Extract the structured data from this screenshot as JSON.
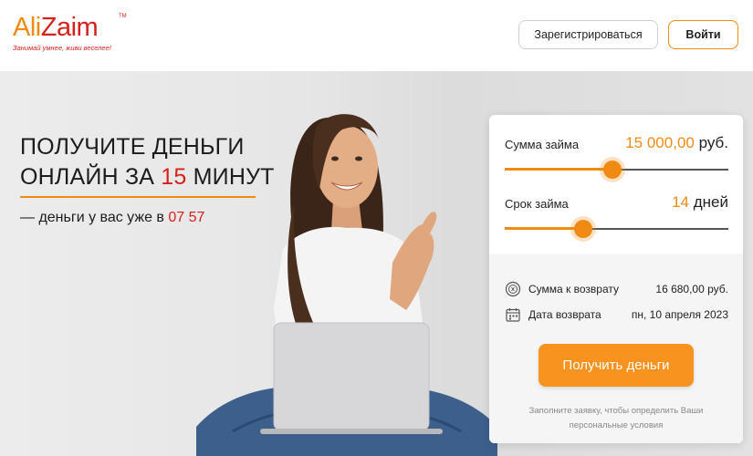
{
  "brand": {
    "logo_ali": "Ali",
    "logo_zaim": "Zaim",
    "trademark": "TM",
    "slogan": "Занимай умнее, живи веселее!",
    "accent_orange": "#f08a12",
    "accent_red": "#d4211c"
  },
  "header": {
    "register_label": "Зарегистрироваться",
    "login_label": "Войти"
  },
  "hero": {
    "headline_line1": "ПОЛУЧИТЕ ДЕНЬГИ",
    "headline_line2_pre": "ОНЛАЙН ЗА ",
    "headline_line2_num": "15",
    "headline_line2_post": " МИНУТ",
    "sub_pre": "— деньги у вас уже в ",
    "sub_time": "07 57"
  },
  "calculator": {
    "amount_label": "Сумма займа",
    "amount_value": "15 000,00",
    "amount_unit": " руб.",
    "amount_slider_fraction": 0.48,
    "term_label": "Срок займа",
    "term_value": "14",
    "term_unit": " дней",
    "term_slider_fraction": 0.35,
    "return_sum_label": "Сумма к возврату",
    "return_sum_value": "16 680,00 руб.",
    "return_date_label": "Дата возврата",
    "return_date_value": "пн, 10 апреля 2023",
    "submit_label": "Получить деньги",
    "hint_line1": "Заполните заявку, чтобы определить Ваши",
    "hint_line2": "персональные условия",
    "icons": [
      "coin-return-icon",
      "calendar-icon"
    ]
  }
}
